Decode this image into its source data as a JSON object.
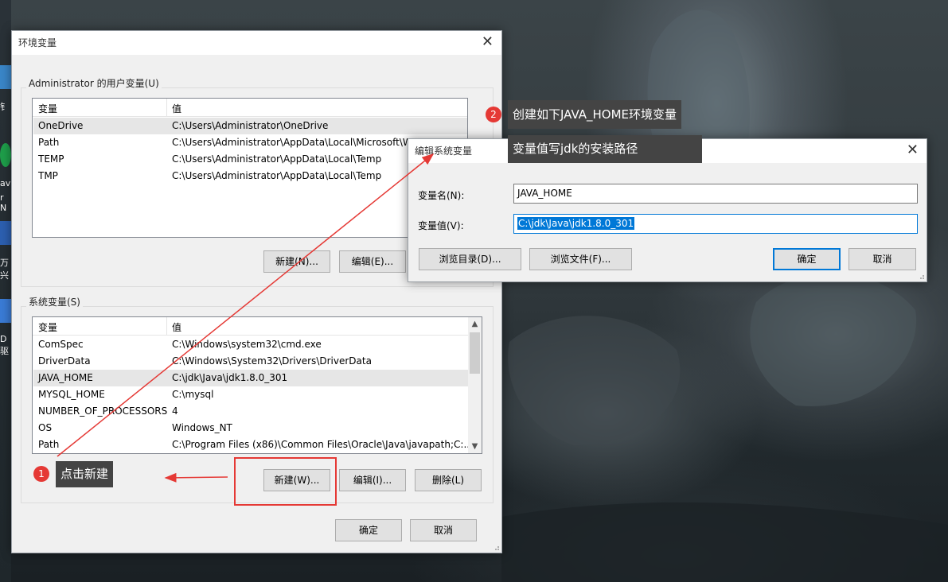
{
  "desktop": {
    "icon_labels": [
      "钅",
      "avi",
      "r N",
      "万兴",
      "D驱"
    ]
  },
  "env_dialog": {
    "title": "环境变量",
    "user_group_label": "Administrator 的用户变量(U)",
    "user_columns": [
      "变量",
      "值"
    ],
    "user_rows": [
      {
        "name": "OneDrive",
        "value": "C:\\Users\\Administrator\\OneDrive"
      },
      {
        "name": "Path",
        "value": "C:\\Users\\Administrator\\AppData\\Local\\Microsoft\\W"
      },
      {
        "name": "TEMP",
        "value": "C:\\Users\\Administrator\\AppData\\Local\\Temp"
      },
      {
        "name": "TMP",
        "value": "C:\\Users\\Administrator\\AppData\\Local\\Temp"
      }
    ],
    "user_buttons": {
      "new": "新建(N)...",
      "edit": "编辑(E)..."
    },
    "sys_group_label": "系统变量(S)",
    "sys_columns": [
      "变量",
      "值"
    ],
    "sys_rows": [
      {
        "name": "ComSpec",
        "value": "C:\\Windows\\system32\\cmd.exe"
      },
      {
        "name": "DriverData",
        "value": "C:\\Windows\\System32\\Drivers\\DriverData"
      },
      {
        "name": "JAVA_HOME",
        "value": "C:\\jdk\\Java\\jdk1.8.0_301"
      },
      {
        "name": "MYSQL_HOME",
        "value": "C:\\mysql"
      },
      {
        "name": "NUMBER_OF_PROCESSORS",
        "value": "4"
      },
      {
        "name": "OS",
        "value": "Windows_NT"
      },
      {
        "name": "Path",
        "value": "C:\\Program Files (x86)\\Common Files\\Oracle\\Java\\javapath;C:..."
      }
    ],
    "sys_buttons": {
      "new": "新建(W)...",
      "edit": "编辑(I)...",
      "delete": "删除(L)"
    },
    "ok": "确定",
    "cancel": "取消"
  },
  "edit_dialog": {
    "title": "编辑系统变量",
    "name_label": "变量名(N):",
    "name_value": "JAVA_HOME",
    "value_label": "变量值(V):",
    "value_value": "C:\\jdk\\Java\\jdk1.8.0_301",
    "browse_dir": "浏览目录(D)...",
    "browse_file": "浏览文件(F)...",
    "ok": "确定",
    "cancel": "取消"
  },
  "annotations": {
    "step1_badge": "1",
    "step1_text": "点击新建",
    "step2_badge": "2",
    "step2_line1": "创建如下JAVA_HOME环境变量",
    "step2_line2": "变量值写jdk的安装路径"
  },
  "colors": {
    "annotation_red": "#e53935",
    "selection_blue": "#0078d7",
    "callout_bg": "#444444"
  }
}
